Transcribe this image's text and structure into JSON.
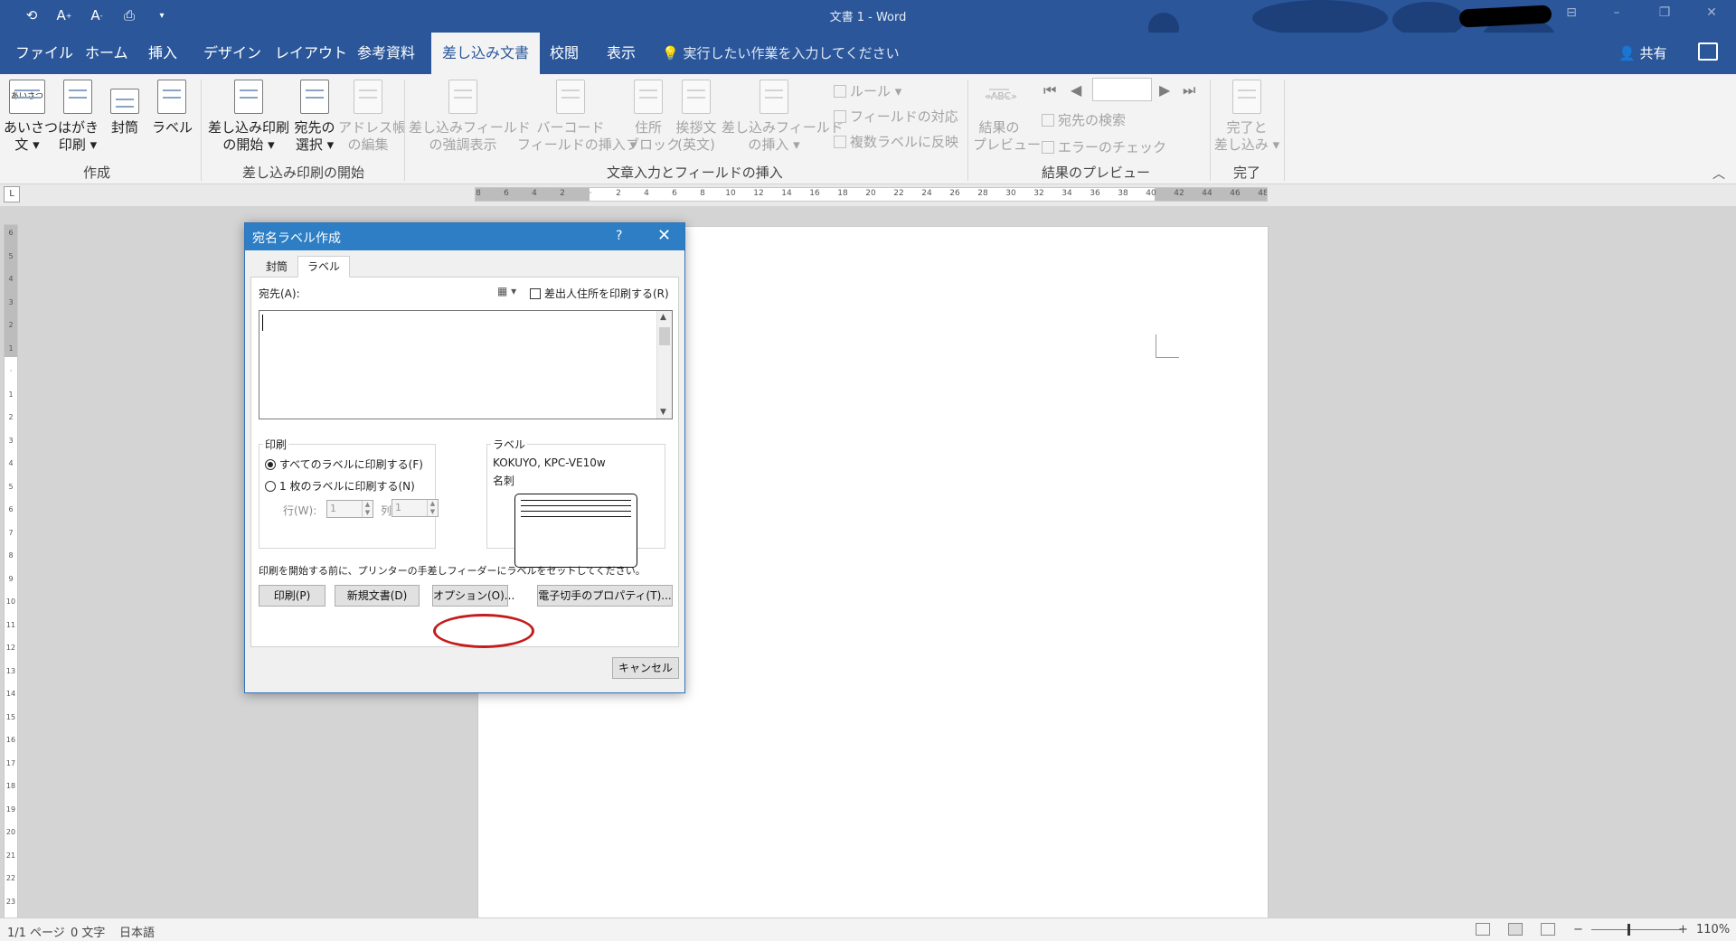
{
  "window": {
    "title": "文書 1 - Word"
  },
  "quick_access": [
    "save-icon",
    "font-grow-icon",
    "font-shrink-icon",
    "print-preview-icon",
    "customize-qat-icon"
  ],
  "tabs": [
    "ファイル",
    "ホーム",
    "挿入",
    "デザイン",
    "レイアウト",
    "参考資料",
    "差し込み文書",
    "校閲",
    "表示"
  ],
  "tell_me": "実行したい作業を入力してください",
  "share": "共有",
  "ribbon": {
    "create": {
      "label": "作成",
      "greeting_1": "あいさつ",
      "greeting_2": "文 ▾",
      "postcard_1": "はがき",
      "postcard_2": "印刷 ▾",
      "envelope": "封筒",
      "labels": "ラベル",
      "greeting_icon_text": "あいさつ"
    },
    "start": {
      "label": "差し込み印刷の開始",
      "start_mm_1": "差し込み印刷",
      "start_mm_2": "の開始 ▾",
      "select_rec_1": "宛先の",
      "select_rec_2": "選択 ▾",
      "edit_list_1": "アドレス帳",
      "edit_list_2": "の編集"
    },
    "write": {
      "label": "文章入力とフィールドの挿入",
      "highlight_1": "差し込みフィールド",
      "highlight_2": "の強調表示",
      "barcode_1": "バーコード",
      "barcode_2": "フィールドの挿入 ▾",
      "address_1": "住所",
      "address_2": "ブロック",
      "greeting_1": "挨拶文",
      "greeting_2": "(英文)",
      "insert_field_1": "差し込みフィールド",
      "insert_field_2": "の挿入 ▾",
      "rules": "ルール ▾",
      "match": "フィールドの対応",
      "update": "複数ラベルに反映"
    },
    "preview": {
      "label": "結果のプレビュー",
      "preview_1": "結果の",
      "preview_2": "プレビュー",
      "preview_icon_text": "«ABC»",
      "find": "宛先の検索",
      "check": "エラーのチェック",
      "record": ""
    },
    "finish": {
      "label": "完了",
      "finish_1": "完了と",
      "finish_2": "差し込み ▾"
    }
  },
  "ruler": {
    "h_ticks": [
      "8",
      "6",
      "4",
      "2",
      "",
      "2",
      "4",
      "6",
      "8",
      "10",
      "12",
      "14",
      "16",
      "18",
      "20",
      "22",
      "24",
      "26",
      "28",
      "30",
      "32",
      "34",
      "36",
      "38",
      "40",
      "42",
      "44",
      "46",
      "48"
    ],
    "v_ticks": [
      "6",
      "5",
      "4",
      "3",
      "2",
      "1",
      "",
      "1",
      "2",
      "3",
      "4",
      "5",
      "6",
      "7",
      "8",
      "9",
      "10",
      "11",
      "12",
      "13",
      "14",
      "15",
      "16",
      "17",
      "18",
      "19",
      "20",
      "21",
      "22",
      "23"
    ],
    "tab_selector": "L"
  },
  "dialog": {
    "title": "宛名ラベル作成",
    "help": "?",
    "close": "✕",
    "tabs": [
      "封筒",
      "ラベル"
    ],
    "address_label": "宛先(A):",
    "address_value": "",
    "use_return_address": "差出人住所を印刷する(R)",
    "print_group": "印刷",
    "full_page": "すべてのラベルに印刷する(F)",
    "single_label": "1 枚のラベルに印刷する(N)",
    "row_label": "行(W):",
    "row_value": "1",
    "col_label": "列(C):",
    "col_value": "1",
    "label_group": "ラベル",
    "label_vendor": "KOKUYO, KPC-VE10w",
    "label_type": "名刺",
    "hint": "印刷を開始する前に、プリンターの手差しフィーダーにラベルをセットしてください。",
    "buttons": {
      "print": "印刷(P)",
      "new_doc": "新規文書(D)",
      "options": "オプション(O)...",
      "epostage": "電子切手のプロパティ(T)...",
      "cancel": "キャンセル"
    }
  },
  "status": {
    "page": "1/1 ページ",
    "words": "0 文字",
    "language": "日本語",
    "zoom_minus": "−",
    "zoom_plus": "+",
    "zoom": "110%"
  },
  "colors": {
    "brand": "#2b579a",
    "dialog_title": "#2d7ec4",
    "highlight": "#c41c1c"
  }
}
